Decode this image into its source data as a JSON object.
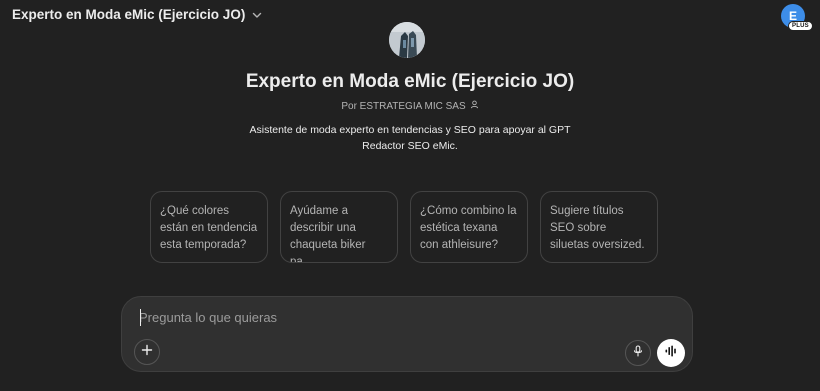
{
  "header": {
    "model_title": "Experto en Moda eMic (Ejercicio JO)",
    "avatar_initial": "E",
    "plan_badge": "PLUS",
    "icons": {
      "dropdown": "chevron-down-icon"
    }
  },
  "gpt": {
    "title": "Experto en Moda eMic (Ejercicio JO)",
    "author": "Por ESTRATEGIA MIC SAS",
    "description": "Asistente de moda experto en tendencias y SEO para apoyar al GPT Redactor SEO eMic.",
    "icons": {
      "author": "person-icon",
      "logo": "gpt-logo-image"
    }
  },
  "suggestions": [
    {
      "text": "¿Qué colores están en tendencia esta temporada?"
    },
    {
      "text": "Ayúdame a describir una chaqueta biker pa..."
    },
    {
      "text": "¿Cómo combino la estética texana con athleisure?"
    },
    {
      "text": "Sugiere títulos SEO sobre siluetas oversized."
    }
  ],
  "composer": {
    "placeholder": "Pregunta lo que quieras",
    "icons": {
      "add": "plus-icon",
      "mic": "microphone-icon",
      "voice": "voice-waveform-icon"
    }
  },
  "colors": {
    "background": "#212121",
    "composer_bg": "#303030",
    "card_border": "#424242",
    "avatar": "#3d8de8",
    "text_primary": "#ececec",
    "text_secondary": "#b4b4b4"
  }
}
